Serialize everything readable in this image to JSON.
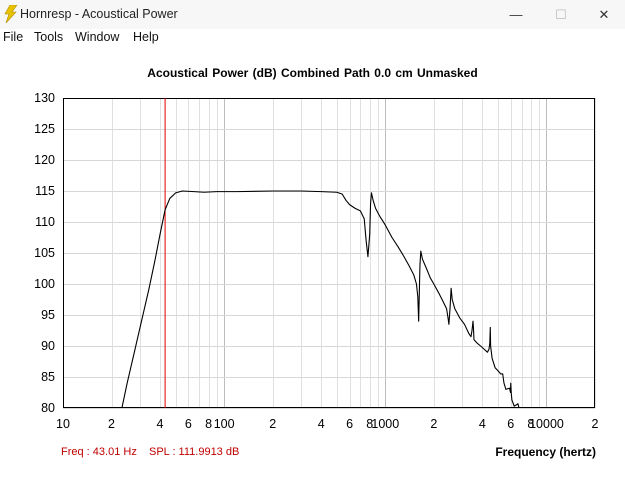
{
  "window": {
    "title": "Hornresp - Acoustical Power",
    "minimize_glyph": "—",
    "maximize_glyph": "☐",
    "close_glyph": "✕"
  },
  "menu": [
    "File",
    "Tools",
    "Window",
    "Help"
  ],
  "readout": {
    "freq": "Freq : 43.01 Hz",
    "spl": "SPL : 111.9913 dB"
  },
  "chart_data": {
    "type": "line",
    "title": "Acoustical Power (dB)   Combined   Path 0.0 cm   Unmasked",
    "xlabel": "Frequency (hertz)",
    "ylabel": "",
    "x_scale": "log",
    "xlim": [
      10,
      20000
    ],
    "ylim": [
      80,
      130
    ],
    "grid": true,
    "legend": "none",
    "y_ticks": [
      130,
      125,
      120,
      115,
      110,
      105,
      100,
      95,
      90,
      85,
      80
    ],
    "x_tick_labels": [
      {
        "x": 10,
        "label": "10"
      },
      {
        "x": 20,
        "label": "2"
      },
      {
        "x": 40,
        "label": "4"
      },
      {
        "x": 60,
        "label": "6"
      },
      {
        "x": 80,
        "label": "8"
      },
      {
        "x": 100,
        "label": "100"
      },
      {
        "x": 200,
        "label": "2"
      },
      {
        "x": 400,
        "label": "4"
      },
      {
        "x": 600,
        "label": "6"
      },
      {
        "x": 800,
        "label": "8"
      },
      {
        "x": 1000,
        "label": "1000"
      },
      {
        "x": 2000,
        "label": "2"
      },
      {
        "x": 4000,
        "label": "4"
      },
      {
        "x": 6000,
        "label": "6"
      },
      {
        "x": 8000,
        "label": "8"
      },
      {
        "x": 10000,
        "label": "10000"
      },
      {
        "x": 20000,
        "label": "2"
      }
    ],
    "cursor": {
      "x": 43.01,
      "color": "#e00000"
    },
    "series": [
      {
        "color": "#000000",
        "points": [
          [
            23.2,
            80
          ],
          [
            25,
            84
          ],
          [
            28,
            89.5
          ],
          [
            31,
            94.5
          ],
          [
            34,
            99
          ],
          [
            37,
            103.5
          ],
          [
            40,
            108
          ],
          [
            43.01,
            111.99
          ],
          [
            46,
            113.8
          ],
          [
            50,
            114.7
          ],
          [
            55,
            115.0
          ],
          [
            65,
            114.9
          ],
          [
            75,
            114.8
          ],
          [
            90,
            114.9
          ],
          [
            120,
            114.9
          ],
          [
            200,
            115.0
          ],
          [
            300,
            115.0
          ],
          [
            400,
            114.9
          ],
          [
            500,
            114.8
          ],
          [
            540,
            114.5
          ],
          [
            570,
            113.5
          ],
          [
            600,
            112.8
          ],
          [
            650,
            112.2
          ],
          [
            700,
            111.8
          ],
          [
            740,
            110.5
          ],
          [
            760,
            107
          ],
          [
            780,
            104.4
          ],
          [
            800,
            108
          ],
          [
            810,
            113
          ],
          [
            820,
            114.7
          ],
          [
            840,
            113.5
          ],
          [
            870,
            112.2
          ],
          [
            920,
            111
          ],
          [
            1000,
            109.5
          ],
          [
            1100,
            107.5
          ],
          [
            1200,
            106
          ],
          [
            1300,
            104.5
          ],
          [
            1400,
            103
          ],
          [
            1500,
            101.5
          ],
          [
            1560,
            100
          ],
          [
            1590,
            98
          ],
          [
            1610,
            94
          ],
          [
            1620,
            97
          ],
          [
            1640,
            103
          ],
          [
            1660,
            105.3
          ],
          [
            1700,
            104
          ],
          [
            1800,
            102.5
          ],
          [
            1900,
            101
          ],
          [
            2000,
            100
          ],
          [
            2150,
            98.5
          ],
          [
            2300,
            97
          ],
          [
            2400,
            96
          ],
          [
            2450,
            94.5
          ],
          [
            2480,
            93.5
          ],
          [
            2520,
            96
          ],
          [
            2560,
            99.3
          ],
          [
            2600,
            97.5
          ],
          [
            2700,
            96
          ],
          [
            2900,
            94.5
          ],
          [
            3100,
            93.5
          ],
          [
            3300,
            92
          ],
          [
            3400,
            91.5
          ],
          [
            3450,
            92.5
          ],
          [
            3500,
            94
          ],
          [
            3520,
            93
          ],
          [
            3550,
            91
          ],
          [
            3700,
            90.5
          ],
          [
            3900,
            90
          ],
          [
            4100,
            89.5
          ],
          [
            4300,
            89
          ],
          [
            4400,
            89.5
          ],
          [
            4450,
            90.5
          ],
          [
            4480,
            93
          ],
          [
            4500,
            90
          ],
          [
            4600,
            88
          ],
          [
            4800,
            86.5
          ],
          [
            5000,
            86
          ],
          [
            5200,
            85.5
          ],
          [
            5350,
            85.5
          ],
          [
            5400,
            84.7
          ],
          [
            5450,
            84
          ],
          [
            5600,
            83
          ],
          [
            5900,
            83.2
          ],
          [
            5980,
            82.5
          ],
          [
            6000,
            84
          ],
          [
            6040,
            82.5
          ],
          [
            6100,
            81.3
          ],
          [
            6200,
            80.8
          ],
          [
            6300,
            80.3
          ],
          [
            6500,
            80.5
          ],
          [
            6650,
            80.7
          ],
          [
            6750,
            80
          ]
        ]
      }
    ]
  }
}
